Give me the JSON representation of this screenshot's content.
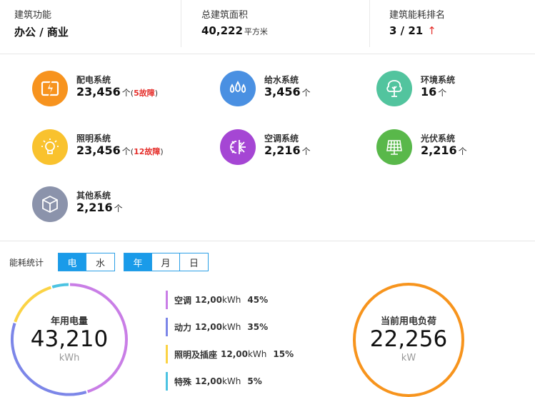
{
  "stats": [
    {
      "label": "建筑功能",
      "value": "办公 / 商业",
      "unit": "",
      "arrow": ""
    },
    {
      "label": "总建筑面积",
      "value": "40,222",
      "unit": "平方米",
      "arrow": ""
    },
    {
      "label": "建筑能耗排名",
      "value": "3 / 21",
      "unit": "",
      "arrow": "↑"
    }
  ],
  "systems": {
    "power": {
      "name": "配电系统",
      "count": "23,456",
      "unit": "个",
      "fault_open": "(",
      "fault_num": "5故障",
      "fault_close": ")",
      "icon": "lightning-icon",
      "color": "#f7931e"
    },
    "water": {
      "name": "给水系统",
      "count": "3,456",
      "unit": "个",
      "icon": "water-drops-icon",
      "color": "#4a90e2"
    },
    "env": {
      "name": "环境系统",
      "count": "16",
      "unit": "个",
      "icon": "tree-icon",
      "color": "#52c49e"
    },
    "light": {
      "name": "照明系统",
      "count": "23,456",
      "unit": "个",
      "fault_open": "(",
      "fault_num": "12故障",
      "fault_close": ")",
      "icon": "lightbulb-icon",
      "color": "#f9c22e"
    },
    "ac": {
      "name": "空调系统",
      "count": "2,216",
      "unit": "个",
      "icon": "snowflake-sun-icon",
      "color": "#a546d4"
    },
    "pv": {
      "name": "光伏系统",
      "count": "2,216",
      "unit": "个",
      "icon": "solar-panel-icon",
      "color": "#59b84a"
    },
    "other": {
      "name": "其他系统",
      "count": "2,216",
      "unit": "个",
      "icon": "cube-icon",
      "color": "#8b93ab"
    }
  },
  "energy": {
    "label": "能耗统计",
    "type_tabs": [
      "电",
      "水"
    ],
    "period_tabs": [
      "年",
      "月",
      "日"
    ],
    "active_type": 0,
    "active_period": 0
  },
  "annual": {
    "title": "年用电量",
    "value": "43,210",
    "unit": "kWh"
  },
  "chart_data": {
    "type": "pie",
    "categories": [
      "空调",
      "动力",
      "照明及插座",
      "特殊"
    ],
    "values": [
      45,
      35,
      15,
      5
    ],
    "amounts": [
      "12,00",
      "12,00",
      "12,00",
      "12,00"
    ],
    "amount_unit": "kWh",
    "percent_labels": [
      "45%",
      "35%",
      "15%",
      "5%"
    ],
    "colors": [
      "#c97ee6",
      "#7c86e8",
      "#fbd345",
      "#4cc3e2"
    ]
  },
  "load": {
    "title": "当前用电负荷",
    "value": "22,256",
    "unit": "kW"
  }
}
